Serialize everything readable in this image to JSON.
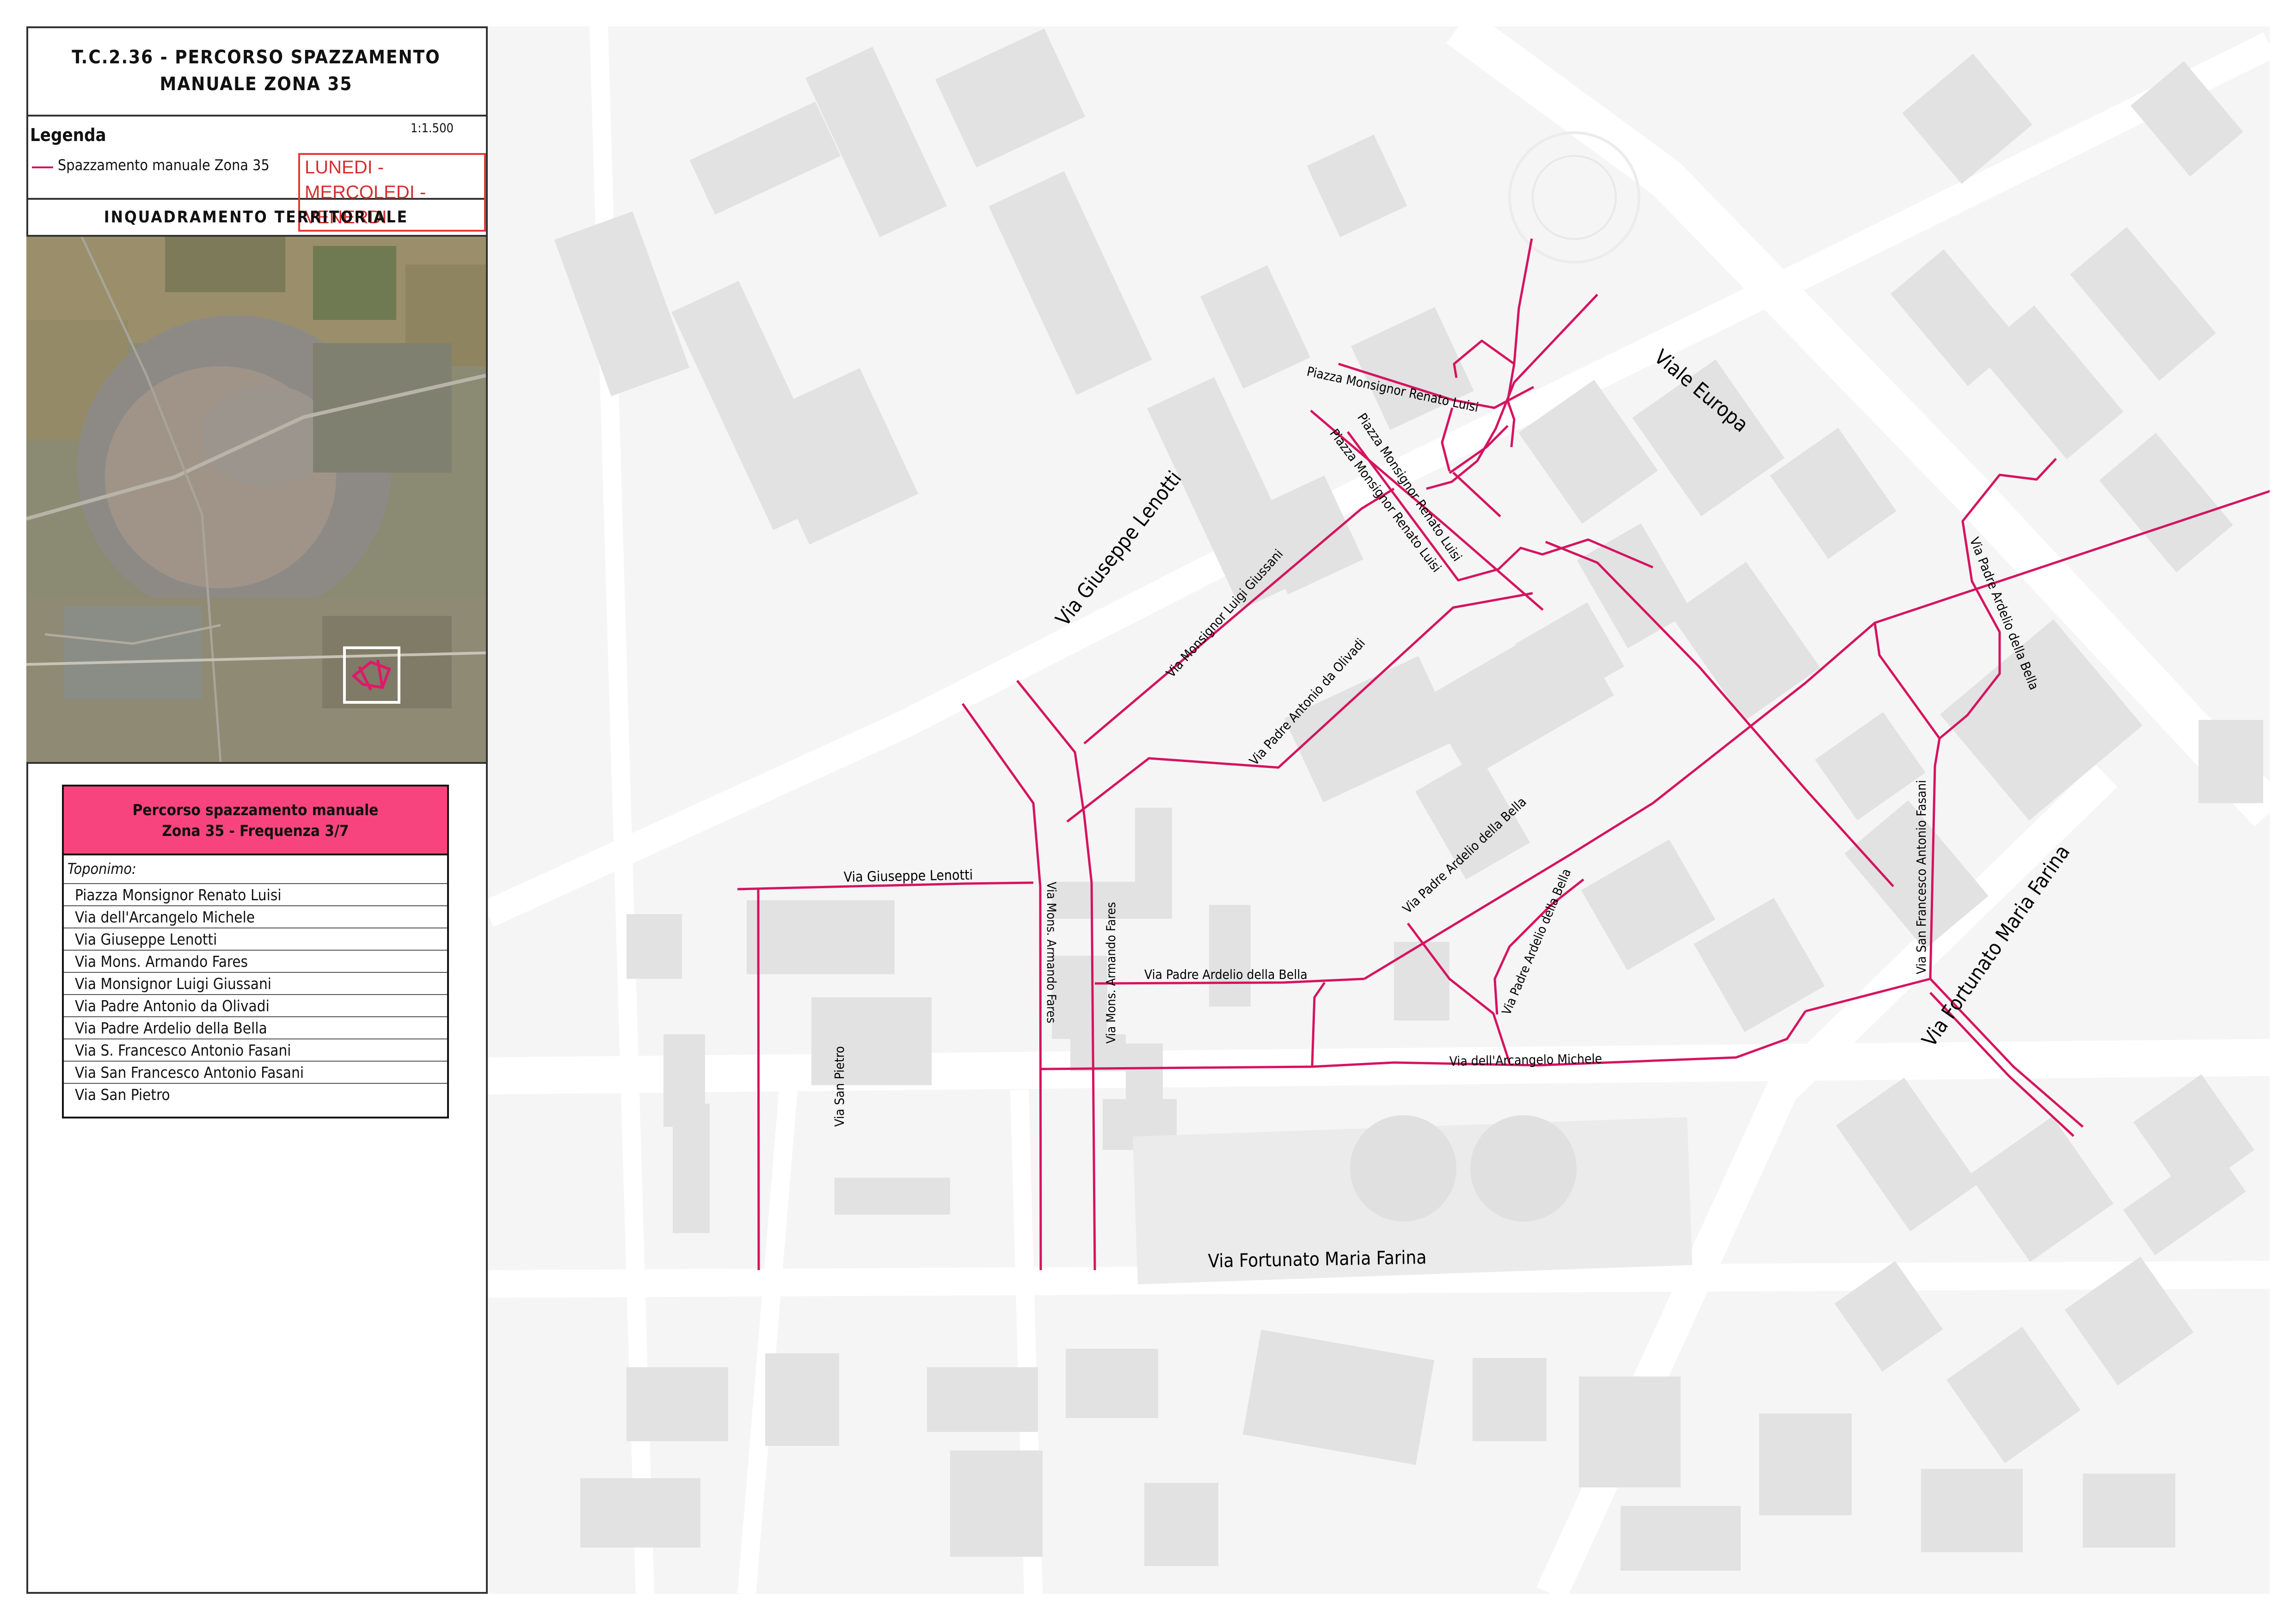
{
  "title": {
    "line1": "T.C.2.36 - PERCORSO SPAZZAMENTO",
    "line2": "MANUALE ZONA 35"
  },
  "legend": {
    "title": "Legenda",
    "scale": "1:1.500",
    "item_label": "Spazzamento manuale Zona 35",
    "days": "LUNEDI - MERCOLEDI - VENERDI",
    "route_color": "#d6135f"
  },
  "inquadramento": {
    "title": "INQUADRAMENTO TERRITORIALE"
  },
  "table": {
    "header_line1": "Percorso spazzamento  manuale",
    "header_line2": "Zona 35 - Frequenza 3/7",
    "header_color": "#f7447f",
    "label": "Toponimo:",
    "rows": [
      "Piazza Monsignor Renato Luisi",
      "Via dell'Arcangelo Michele",
      "Via Giuseppe Lenotti",
      "Via Mons. Armando Fares",
      "Via Monsignor Luigi Giussani",
      "Via Padre Antonio da Olivadi",
      "Via Padre Ardelio della Bella",
      "Via S. Francesco Antonio Fasani",
      "Via San Francesco Antonio Fasani",
      "Via San Pietro"
    ]
  },
  "map": {
    "route_color": "#d6135f",
    "labels": {
      "viale_europa": "Viale Europa",
      "lenotti_main": "Via Giuseppe Lenotti",
      "lenotti_route": "Via Giuseppe Lenotti",
      "luisi_top": "Piazza Monsignor Renato Luisi",
      "luisi_diag1": "Piazza Monsignor Renato Luisi",
      "luisi_diag2": "Piazza Monsignor Renato Luisi",
      "giussani": "Via Monsignor Luigi Giussani",
      "olivadi": "Via Padre Antonio da Olivadi",
      "bella_right": "Via Padre Ardelio della Bella",
      "bella_diag": "Via Padre Ardelio della Bella",
      "bella_horiz": "Via Padre Ardelio della Bella",
      "bella_small": "Via Padre Ardelio della Bella",
      "fasani": "Via San Francesco Antonio Fasani",
      "farina_diag": "Via Fortunato Maria Farina",
      "farina_bottom": "Via Fortunato Maria Farina",
      "fares1": "Via Mons. Armando Fares",
      "fares2": "Via Mons. Armando Fares",
      "san_pietro": "Via San Pietro",
      "arcangelo": "Via dell'Arcangelo Michele"
    }
  }
}
